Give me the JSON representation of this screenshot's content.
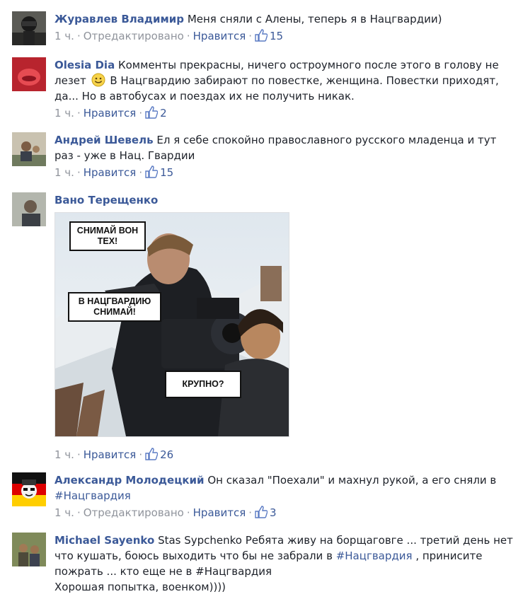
{
  "comments": [
    {
      "author": "Журавлев Владимир",
      "text": "Меня сняли с Алены, теперь я в Нацгвардии)",
      "time": "1 ч.",
      "edited": "Отредактировано",
      "like": "Нравится",
      "likes": "15"
    },
    {
      "author": "Olesia Dia",
      "text_a": "Комменты прекрасны, ничего остроумного после этого в голову не лезет",
      "text_b": "В Нацгвардию забирают по повестке, женщина. Повестки приходят, да... Но в автобусах и поездах их не получить никак.",
      "time": "1 ч.",
      "like": "Нравится",
      "likes": "2"
    },
    {
      "author": "Андрей Шевель",
      "text": "Ел я себе спокойно православного русского младенца и тут раз - уже в Нац. Гвардии",
      "time": "1 ч.",
      "like": "Нравится",
      "likes": "15"
    },
    {
      "author": "Вано Терещенко",
      "meme": {
        "bubble1": "СНИМАЙ ВОН ТЕХ!",
        "bubble2": "В НАЦГВАРДИЮ СНИМАЙ!",
        "bubble3": "КРУПНО?"
      },
      "time": "1 ч.",
      "like": "Нравится",
      "likes": "26"
    },
    {
      "author": "Александр Молодецкий",
      "text": "Он сказал \"Поехали\" и махнул рукой, а его сняли в",
      "hashtag": "#Нацгвардия",
      "time": "1 ч.",
      "edited": "Отредактировано",
      "like": "Нравится",
      "likes": "3"
    },
    {
      "author": "Michael Sayenko",
      "text_a": "Stas Sypchenko Ребята живу на борщаговге ... третий день нет что кушать, боюсь выходить что бы не забрали в",
      "hashtag_a": "#Нацгвардия",
      "text_b": ", принисите пожрать ... кто еще не в",
      "hashtag_b": "#Нацгвардия",
      "text_c": "Хорошая попытка, военком))))"
    }
  ],
  "colors": {
    "link": "#3b5998",
    "meta": "#90949c",
    "text": "#1d2129"
  }
}
